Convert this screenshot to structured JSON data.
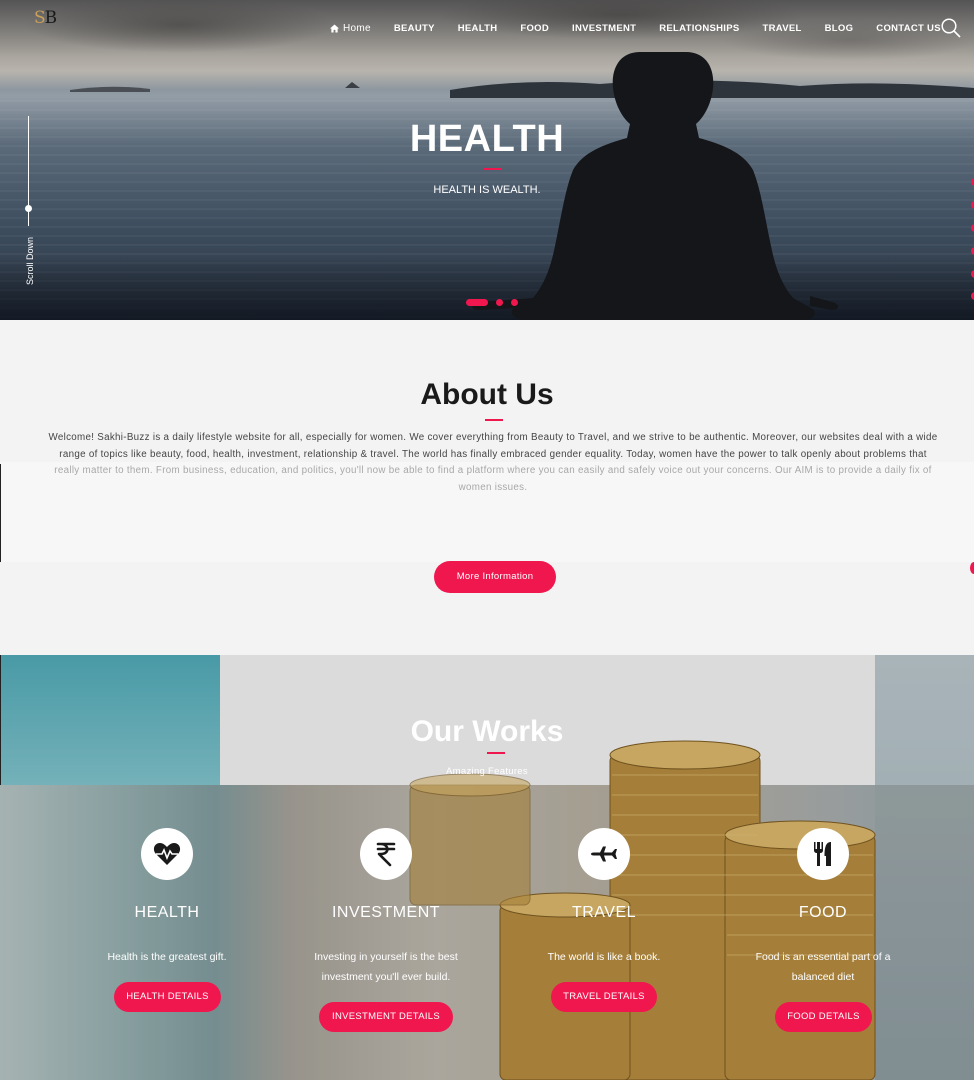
{
  "brand": {
    "logo_text_1": "S",
    "logo_text_2": "B"
  },
  "nav": {
    "items": [
      {
        "label": "Home",
        "icon": "home-icon"
      },
      {
        "label": "BEAUTY"
      },
      {
        "label": "HEALTH"
      },
      {
        "label": "FOOD"
      },
      {
        "label": "INVESTMENT"
      },
      {
        "label": "RELATIONSHIPS"
      },
      {
        "label": "TRAVEL"
      },
      {
        "label": "BLOG"
      },
      {
        "label": "CONTACT US"
      }
    ],
    "search_icon": "search-icon"
  },
  "hero": {
    "scroll_label": "Scroll Down",
    "title": "HEALTH",
    "subtitle": "HEALTH IS WEALTH.",
    "accent_color": "#f0174f",
    "slides_count": 3,
    "active_slide": 1
  },
  "about": {
    "title": "About Us",
    "text": "Welcome! Sakhi-Buzz is a daily lifestyle website for all, especially for women. We cover everything from Beauty to Travel, and we strive to be authentic. Moreover, our websites deal with a wide range of topics like beauty, food, health, investment, relationship & travel. The world has finally embraced gender equality. Today, women have the power to talk openly about problems that really matter to them. From business, education, and politics, you'll now be able to find a platform where you can easily and safely voice out your concerns. Our AIM is to provide a daily fix of women issues.",
    "button_label": "More Information"
  },
  "works": {
    "title": "Our Works",
    "subtitle": "Amazing Features",
    "items": [
      {
        "icon": "heartbeat-icon",
        "title": "HEALTH",
        "text": "Health is the greatest gift.",
        "button": "HEALTH DETAILS"
      },
      {
        "icon": "rupee-icon",
        "title": "INVESTMENT",
        "text": "Investing in yourself is the best investment you'll ever build.",
        "button": "INVESTMENT DETAILS"
      },
      {
        "icon": "airplane-icon",
        "title": "TRAVEL",
        "text": "The world is like a book.",
        "button": "TRAVEL DETAILS"
      },
      {
        "icon": "utensils-icon",
        "title": "FOOD",
        "text": "Food is an essential part of a balanced diet",
        "button": "FOOD DETAILS"
      }
    ]
  }
}
